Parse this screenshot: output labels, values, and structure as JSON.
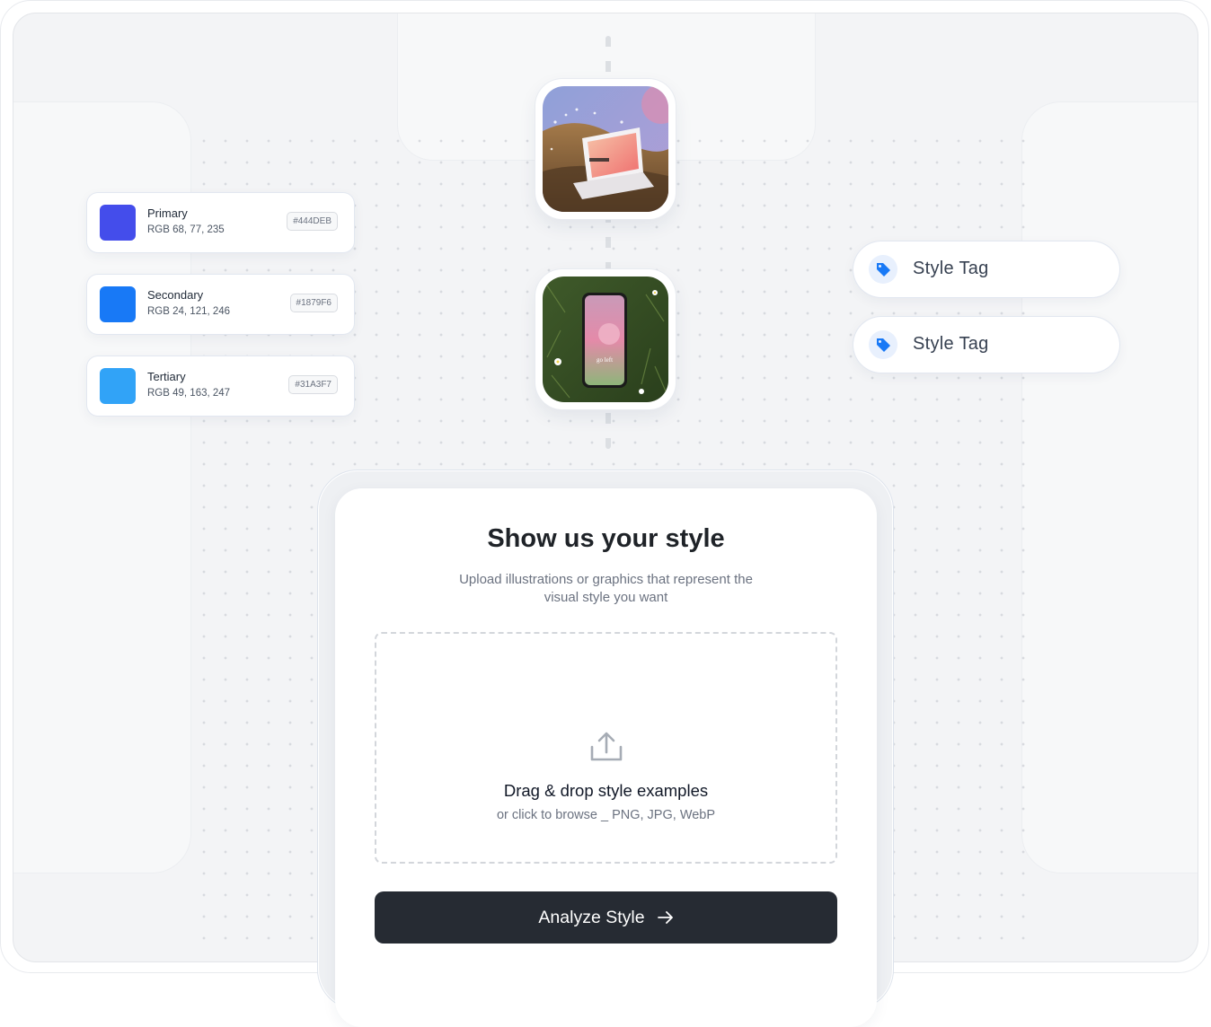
{
  "colors": [
    {
      "name": "Primary",
      "rgb": "RGB  68, 77, 235",
      "hex": "#444DEB",
      "swatch": "#444DEB"
    },
    {
      "name": "Secondary",
      "rgb": "RGB  24, 121, 246",
      "hex": "#1879F6",
      "swatch": "#1879F6"
    },
    {
      "name": "Tertiary",
      "rgb": "RGB  49, 163, 247",
      "hex": "#31A3F7",
      "swatch": "#31A3F7"
    }
  ],
  "style_tags": [
    {
      "label": "Style Tag"
    },
    {
      "label": "Style Tag"
    }
  ],
  "images": {
    "laptop_photo": "laptop-in-meadow",
    "phone_photo": "phone-in-grass",
    "phone_screen_text": "go left"
  },
  "upload_card": {
    "title": "Show us your style",
    "subtitle": "Upload illustrations or graphics that represent the visual style you want",
    "dropzone_title": "Drag & drop style examples",
    "dropzone_sub": "or click to browse _ PNG, JPG, WebP",
    "button_label": "Analyze Style"
  },
  "accent": "#1879F6",
  "button_color": "#262B33"
}
